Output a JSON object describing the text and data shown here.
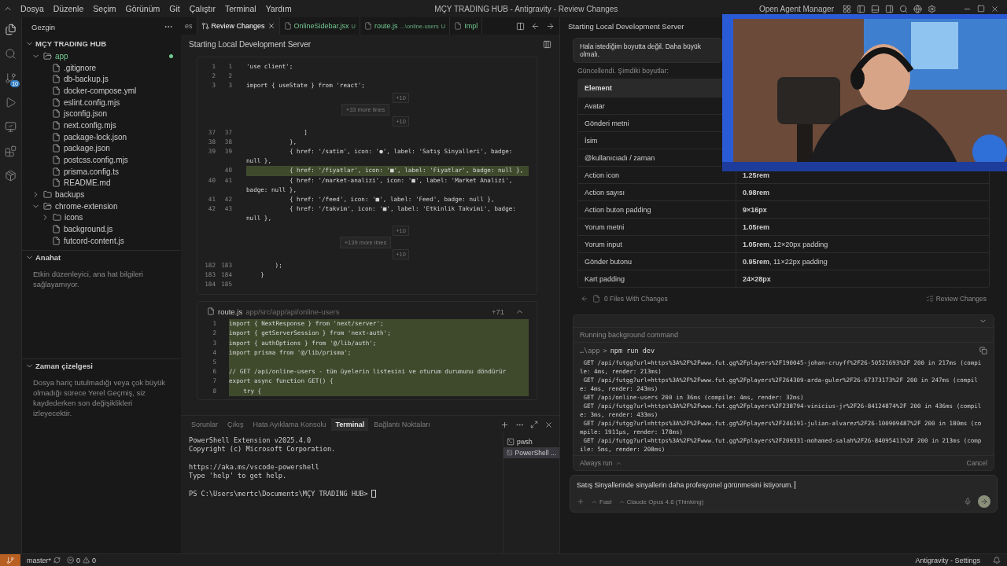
{
  "title_bar": {
    "menu": [
      "Dosya",
      "Düzenle",
      "Seçim",
      "Görünüm",
      "Git",
      "Çalıştır",
      "Terminal",
      "Yardım"
    ],
    "title": "MÇY TRADING HUB - Antigravity - Review Changes",
    "agent_manager": "Open Agent Manager"
  },
  "activity_bar": {
    "scm_badge": "10"
  },
  "explorer": {
    "title": "Gezgin",
    "root": "MÇY TRADING HUB",
    "tree": [
      {
        "name": "app",
        "kind": "folder",
        "expanded": true,
        "modified": true,
        "children": [
          {
            "name": ".gitignore",
            "kind": "file"
          },
          {
            "name": "db-backup.js",
            "kind": "file"
          },
          {
            "name": "docker-compose.yml",
            "kind": "file"
          },
          {
            "name": "eslint.config.mjs",
            "kind": "file"
          },
          {
            "name": "jsconfig.json",
            "kind": "file"
          },
          {
            "name": "next.config.mjs",
            "kind": "file"
          },
          {
            "name": "package-lock.json",
            "kind": "file"
          },
          {
            "name": "package.json",
            "kind": "file"
          },
          {
            "name": "postcss.config.mjs",
            "kind": "file"
          },
          {
            "name": "prisma.config.ts",
            "kind": "file"
          },
          {
            "name": "README.md",
            "kind": "file"
          }
        ]
      },
      {
        "name": "backups",
        "kind": "folder",
        "expanded": false,
        "modified": false
      },
      {
        "name": "chrome-extension",
        "kind": "folder",
        "expanded": true,
        "modified": false,
        "children": [
          {
            "name": "icons",
            "kind": "folder",
            "expanded": false,
            "modified": false
          },
          {
            "name": "background.js",
            "kind": "file"
          },
          {
            "name": "futcord-content.js",
            "kind": "file"
          }
        ]
      }
    ],
    "outline": {
      "title": "Anahat",
      "text": "Etkin düzenleyici, ana hat bilgileri sağlayamıyor."
    },
    "timeline": {
      "title": "Zaman çizelgesi",
      "text": "Dosya hariç tutulmadığı veya çok büyük olmadığı sürece Yerel Geçmiş, siz kaydederken son değişiklikleri izleyecektir."
    }
  },
  "editor": {
    "tabs": [
      {
        "label": "es",
        "kind": "plain",
        "selected": false
      },
      {
        "label": "Review Changes",
        "kind": "diff",
        "selected": true
      },
      {
        "label": "OnlineSidebar.jsx",
        "kind": "file",
        "status": "U",
        "selected": false
      },
      {
        "label": "route.js",
        "kind": "file",
        "detail": "...\\online-users",
        "status": "U",
        "selected": false
      },
      {
        "label": "Impl",
        "kind": "file",
        "selected": false
      }
    ],
    "header": "Starting Local Development Server",
    "diff": [
      {
        "kind": "line",
        "old": "1",
        "new": "1",
        "text": "'use client';",
        "added": false
      },
      {
        "kind": "line",
        "old": "2",
        "new": "2",
        "added": false
      },
      {
        "kind": "line",
        "old": "3",
        "new": "3",
        "text": "import { useState } from 'react';",
        "added": false
      },
      {
        "kind": "fold",
        "up": "+10",
        "label": "+33 more lines",
        "down": "+10"
      },
      {
        "kind": "line",
        "old": "37",
        "new": "37",
        "text": "                ]",
        "added": false
      },
      {
        "kind": "line",
        "old": "38",
        "new": "38",
        "text": "            },",
        "added": false
      },
      {
        "kind": "line",
        "old": "39",
        "new": "39",
        "text": "            { href: '/satim', icon: '●', label: 'Satış Sinyalleri', badge: null },",
        "added": false
      },
      {
        "kind": "line",
        "new": "40",
        "text": "            { href: '/fiyatlar', icon: '■', label: 'Fiyatlar', badge: null },",
        "added": true
      },
      {
        "kind": "line",
        "old": "40",
        "new": "41",
        "text": "            { href: '/market-analizi', icon: '■', label: 'Market Analizi', badge: null },",
        "added": false
      },
      {
        "kind": "line",
        "old": "41",
        "new": "42",
        "text": "            { href: '/feed', icon: '■', label: 'Feed', badge: null },",
        "added": false
      },
      {
        "kind": "line",
        "old": "42",
        "new": "43",
        "text": "            { href: '/takvim', icon: '■', label: 'Etkinlik Takvimi', badge: null },",
        "added": false
      },
      {
        "kind": "fold",
        "up": "+10",
        "label": "+139 more lines",
        "down": "+10"
      },
      {
        "kind": "line",
        "old": "182",
        "new": "183",
        "text": "        );",
        "added": false
      },
      {
        "kind": "line",
        "old": "183",
        "new": "184",
        "text": "    }",
        "added": false
      },
      {
        "kind": "line",
        "old": "184",
        "new": "185",
        "added": false
      }
    ],
    "route": {
      "name": "route.js",
      "path": "app/src/app/api/online-users",
      "count": "+71",
      "expanded": true,
      "lines": [
        {
          "num": "1",
          "text": "import { NextResponse } from 'next/server';"
        },
        {
          "num": "2",
          "text": "import { getServerSession } from 'next-auth';"
        },
        {
          "num": "3",
          "text": "import { authOptions } from '@/lib/auth';"
        },
        {
          "num": "4",
          "text": "import prisma from '@/lib/prisma';"
        },
        {
          "num": "5"
        },
        {
          "num": "6",
          "text": "// GET /api/online-users - tüm üyelerin listesini ve oturum durumunu döndürür"
        },
        {
          "num": "7",
          "text": "export async function GET() {"
        },
        {
          "num": "8",
          "text": "    try {"
        }
      ]
    }
  },
  "panel": {
    "tabs": [
      {
        "label": "Sorunlar",
        "selected": false
      },
      {
        "label": "Çıkış",
        "selected": false
      },
      {
        "label": "Hata Ayıklama Konsolu",
        "selected": false
      },
      {
        "label": "Terminal",
        "selected": true
      },
      {
        "label": "Bağlantı Noktaları",
        "selected": false
      }
    ],
    "blocks": [
      [
        "PowerShell Extension v2025.4.0",
        "Copyright (c) Microsoft Corporation."
      ],
      [
        "https://aka.ms/vscode-powershell",
        "Type 'help' to get help."
      ]
    ],
    "prompt": "PS C:\\Users\\mertc\\Documents\\MÇY TRADING HUB>",
    "sessions": [
      {
        "label": "pwsh",
        "selected": false
      },
      {
        "label": "PowerShell ...",
        "selected": true
      }
    ]
  },
  "agent": {
    "header": "Starting Local Development Server",
    "message": "Hala istediğim boyutta değil. Daha büyük olmalı.",
    "intro": "Güncellendi. Şimdiki boyutlar:",
    "table": {
      "columns": [
        "Element"
      ],
      "rows": [
        {
          "element": "Avatar"
        },
        {
          "element": "Gönderi metni"
        },
        {
          "element": "İsim"
        },
        {
          "element": "@kullanıcıadı / zaman"
        },
        {
          "element": "Action icon",
          "value": "1.25rem"
        },
        {
          "element": "Action sayısı",
          "value": "0.98rem"
        },
        {
          "element": "Action buton padding",
          "value": "9×16px"
        },
        {
          "element": "Yorum metni",
          "value": "1.05rem"
        },
        {
          "element": "Yorum input",
          "value": "1.05rem",
          "note": ", 12×20px padding"
        },
        {
          "element": "Gönder butonu",
          "value": "0.95rem",
          "note": ", 11×22px padding"
        },
        {
          "element": "Kart padding",
          "value": "24×28px"
        }
      ]
    },
    "files": {
      "label": "0 Files With Changes",
      "action": "Review Changes"
    },
    "command": {
      "status": "Running background command",
      "cwd": "…\\app",
      "separator": ">",
      "command": "npm run dev",
      "output": [
        " GET /api/futgg?url=https%3A%2F%2Fwww.fut.gg%2Fplayers%2F190045-johan-cruyff%2F26-50521693%2F 200 in 217ms (compile: 4ms, render: 213ms)",
        " GET /api/futgg?url=https%3A%2F%2Fwww.fut.gg%2Fplayers%2F264309-arda-guler%2F26-67373173%2F 200 in 247ms (compile: 4ms, render: 243ms)",
        " GET /api/online-users 200 in 36ms (compile: 4ms, render: 32ms)",
        " GET /api/futgg?url=https%3A%2F%2Fwww.fut.gg%2Fplayers%2F238794-vinicius-jr%2F26-84124874%2F 200 in 436ms (compile: 3ms, render: 433ms)",
        " GET /api/futgg?url=https%3A%2F%2Fwww.fut.gg%2Fplayers%2F246191-julian-alvarez%2F26-100909487%2F 200 in 180ms (compile: 1911µs, render: 178ms)",
        " GET /api/futgg?url=https%3A%2F%2Fwww.fut.gg%2Fplayers%2F209331-mohamed-salah%2F26-84095411%2F 200 in 213ms (compile: 5ms, render: 208ms)"
      ],
      "always_run": "Always run",
      "cancel": "Cancel"
    },
    "input": {
      "value": "Satış Sinyallerinde sinyallerin daha profesyonel görünmesini istiyorum.",
      "mode": "Fast",
      "model": "Claude Opus 4.6 (Thinking)"
    }
  },
  "status_bar": {
    "branch": "master*",
    "errors": "0",
    "warnings": "0",
    "right": "Antigravity - Settings"
  }
}
